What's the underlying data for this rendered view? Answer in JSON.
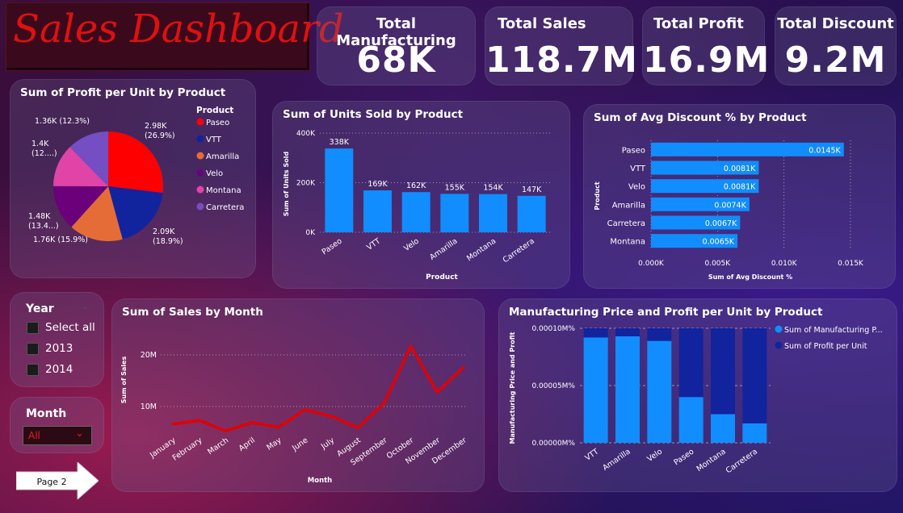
{
  "header": {
    "title": "Sales Dashboard"
  },
  "kpis": [
    {
      "label": "Total Manufacturing",
      "value": "68K"
    },
    {
      "label": "Total Sales",
      "value": "118.7M"
    },
    {
      "label": "Total Profit",
      "value": "16.9M"
    },
    {
      "label": "Total Discount",
      "value": "9.2M"
    }
  ],
  "slicers": {
    "year": {
      "label": "Year",
      "options": [
        "Select all",
        "2013",
        "2014"
      ]
    },
    "month": {
      "label": "Month",
      "selected": "All"
    }
  },
  "nav": {
    "page_button": "Page 2"
  },
  "colors": {
    "bar": "#118dff",
    "dark_bar": "#12239e",
    "line": "#e00000",
    "title_red": "#e01010"
  },
  "chart_data": [
    {
      "type": "pie",
      "title": "Sum of Profit per Unit by Product",
      "legend_title": "Product",
      "legend_position": "right",
      "slices": [
        {
          "name": "Paseo",
          "value": 2.98,
          "label": "2.98K",
          "pct": "(26.9%)",
          "color": "#ff0000"
        },
        {
          "name": "VTT",
          "value": 2.09,
          "label": "2.09K",
          "pct": "(18.9%)",
          "color": "#12239e"
        },
        {
          "name": "Amarilla",
          "value": 1.76,
          "label": "1.76K (15.9%)",
          "pct": "",
          "color": "#e66c37"
        },
        {
          "name": "Velo",
          "value": 1.48,
          "label": "1.48K",
          "pct": "(13.4...)",
          "color": "#6b007b"
        },
        {
          "name": "Montana",
          "value": 1.4,
          "label": "1.4K",
          "pct": "(12....)",
          "color": "#e044a7"
        },
        {
          "name": "Carretera",
          "value": 1.36,
          "label": "1.36K (12.3%)",
          "pct": "",
          "color": "#744ec2"
        }
      ]
    },
    {
      "type": "bar",
      "title": "Sum of Units Sold by Product",
      "categories": [
        "Paseo",
        "VTT",
        "Velo",
        "Amarilla",
        "Montana",
        "Carretera"
      ],
      "values": [
        338,
        169,
        162,
        155,
        154,
        147
      ],
      "data_labels": [
        "338K",
        "169K",
        "162K",
        "155K",
        "154K",
        "147K"
      ],
      "yticks": [
        "0K",
        "200K",
        "400K"
      ],
      "ylim": [
        0,
        400
      ],
      "xlabel": "Product",
      "ylabel": "Sum of Units Sold",
      "grid": true
    },
    {
      "type": "bar",
      "orientation": "horizontal",
      "title": "Sum of Avg Discount % by Product",
      "categories": [
        "Paseo",
        "VTT",
        "Velo",
        "Amarilla",
        "Carretera",
        "Montana"
      ],
      "values": [
        0.0145,
        0.0081,
        0.0081,
        0.0074,
        0.0067,
        0.0065
      ],
      "data_labels": [
        "0.0145K",
        "0.0081K",
        "0.0081K",
        "0.0074K",
        "0.0067K",
        "0.0065K"
      ],
      "xticks": [
        "0.000K",
        "0.005K",
        "0.010K",
        "0.015K"
      ],
      "xlim": [
        0,
        0.015
      ],
      "xlabel": "Sum of Avg Discount %",
      "ylabel": "Product",
      "grid": true
    },
    {
      "type": "line",
      "title": "Sum of Sales by Month",
      "categories": [
        "January",
        "February",
        "March",
        "April",
        "May",
        "June",
        "July",
        "August",
        "September",
        "October",
        "November",
        "December"
      ],
      "values": [
        6.6,
        7.3,
        5.3,
        6.9,
        6.0,
        9.4,
        8.1,
        5.9,
        10.7,
        21.7,
        12.8,
        17.6
      ],
      "yticks": [
        "10M",
        "20M"
      ],
      "ylim": [
        0,
        25
      ],
      "xlabel": "Month",
      "ylabel": "Sum of Sales",
      "grid": true
    },
    {
      "type": "bar",
      "stacked": "100%",
      "title": "Manufacturing Price and Profit per Unit by Product",
      "categories": [
        "VTT",
        "Amarilla",
        "Velo",
        "Paseo",
        "Montana",
        "Carretera"
      ],
      "series": [
        {
          "name": "Sum of Manufacturing P...",
          "values": [
            0.92,
            0.93,
            0.89,
            0.4,
            0.25,
            0.17
          ],
          "color": "#118dff"
        },
        {
          "name": "Sum of Profit per Unit",
          "values": [
            0.08,
            0.07,
            0.11,
            0.6,
            0.75,
            0.83
          ],
          "color": "#12239e"
        }
      ],
      "yticks": [
        "0.00000M%",
        "0.00005M%",
        "0.00010M%"
      ],
      "ylabel": "Manufacturing Price and Profit",
      "legend_position": "right"
    }
  ]
}
